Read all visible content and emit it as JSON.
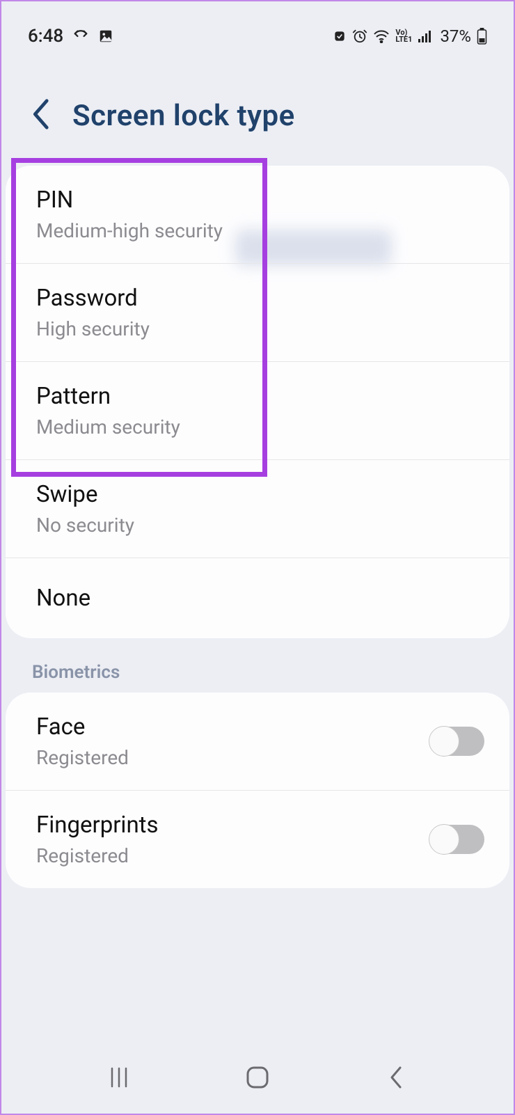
{
  "status": {
    "time": "6:48",
    "battery_text": "37%"
  },
  "header": {
    "title": "Screen lock type"
  },
  "lock_types": [
    {
      "title": "PIN",
      "sub": "Medium-high security"
    },
    {
      "title": "Password",
      "sub": "High security"
    },
    {
      "title": "Pattern",
      "sub": "Medium security"
    },
    {
      "title": "Swipe",
      "sub": "No security"
    },
    {
      "title": "None",
      "sub": ""
    }
  ],
  "biometrics_label": "Biometrics",
  "biometrics": [
    {
      "title": "Face",
      "sub": "Registered",
      "enabled": false
    },
    {
      "title": "Fingerprints",
      "sub": "Registered",
      "enabled": false
    }
  ]
}
